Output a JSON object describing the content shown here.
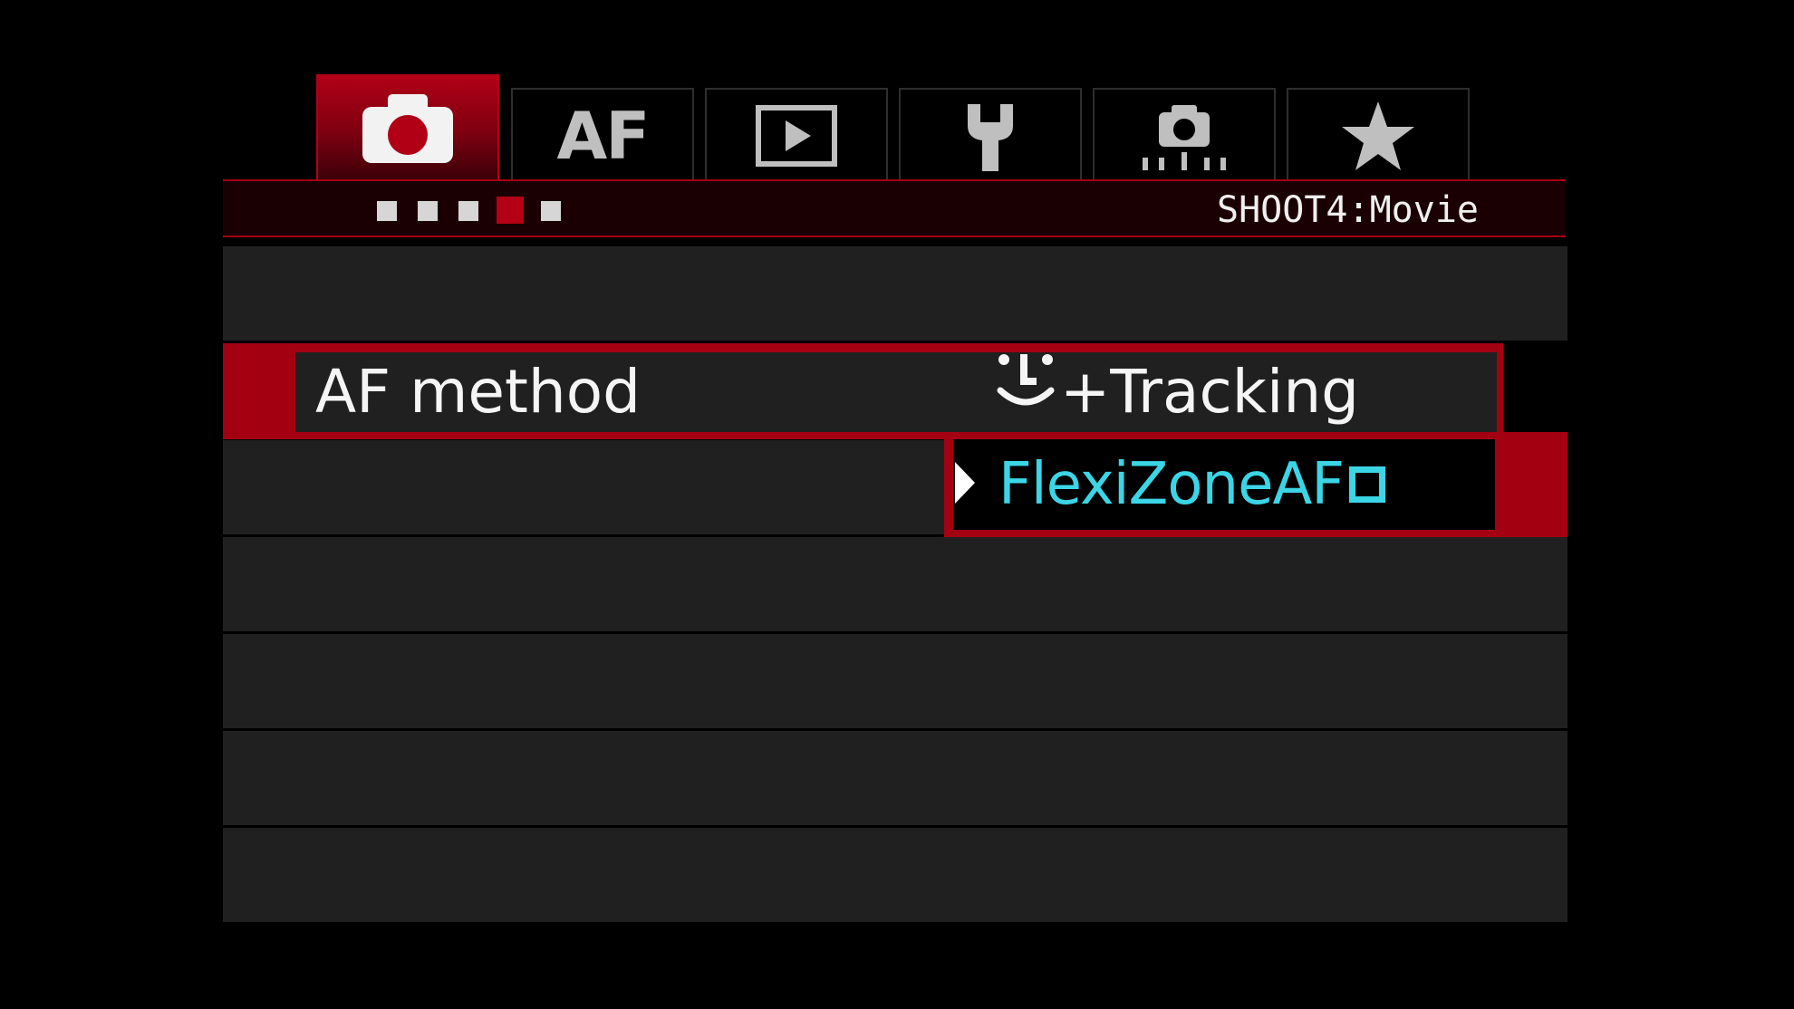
{
  "tabs": [
    {
      "name": "shooting",
      "icon": "camera-icon",
      "active": true
    },
    {
      "name": "af",
      "label": "AF",
      "active": false
    },
    {
      "name": "playback",
      "icon": "playback-icon",
      "active": false
    },
    {
      "name": "setup",
      "icon": "wrench-icon",
      "active": false
    },
    {
      "name": "custom-functions",
      "icon": "camera-settings-icon",
      "active": false
    },
    {
      "name": "my-menu",
      "icon": "star-icon",
      "active": false
    }
  ],
  "header": {
    "title": "SHOOT4:Movie",
    "pages_total": 5,
    "active_page": 4
  },
  "menu": {
    "item_label": "AF method",
    "current_value": "+Tracking",
    "current_value_icon": "face-icon"
  },
  "dropdown": {
    "option": "FlexiZoneAF",
    "option_icon": "single-square-icon",
    "highlight_color": "#3bd5e6"
  },
  "colors": {
    "accent": "#a30012",
    "row_bg": "#202020",
    "background": "#000000"
  }
}
